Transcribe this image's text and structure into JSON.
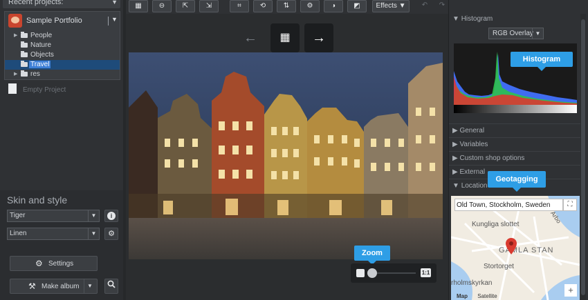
{
  "sidebar": {
    "recent_label": "Recent projects:",
    "project_name": "Sample Portfolio",
    "tree": [
      {
        "label": "People",
        "expandable": true,
        "selected": false
      },
      {
        "label": "Nature",
        "expandable": false,
        "selected": false
      },
      {
        "label": "Objects",
        "expandable": false,
        "selected": false
      },
      {
        "label": "Travel",
        "expandable": false,
        "selected": true
      },
      {
        "label": "res",
        "expandable": true,
        "selected": false
      }
    ],
    "empty_project": "Empty Project",
    "skin_title": "Skin and style",
    "skin_value": "Tiger",
    "style_value": "Linen",
    "settings_label": "Settings",
    "make_album_label": "Make album"
  },
  "toolbar": {
    "effects_label": "Effects ▼"
  },
  "viewer": {
    "prev_icon": "arrow-left-icon",
    "grid_icon": "grid-icon",
    "next_icon": "arrow-right-icon",
    "zoom_callout": "Zoom",
    "one_to_one": "1:1"
  },
  "right": {
    "histogram_header": "Histogram",
    "histogram_mode": "RGB Overlay",
    "histogram_callout": "Histogram",
    "sections": [
      "General",
      "Variables",
      "Custom shop options",
      "External",
      "Location"
    ],
    "geotag_callout": "Geotagging",
    "map_search": "Old Town, Stockholm, Sweden",
    "map_labels": {
      "kungliga": "Kungliga slottet",
      "gamla": "GAMLA STAN",
      "stortorget": "Stortorget",
      "holmskyrkan": "rholmskyrkan",
      "arbo": "Arbo"
    },
    "map_tab_map": "Map",
    "map_tab_sat": "Satellite"
  },
  "colors": {
    "accent": "#2e9ee6",
    "selection": "#3d7fd6",
    "pin": "#d93a2f"
  }
}
